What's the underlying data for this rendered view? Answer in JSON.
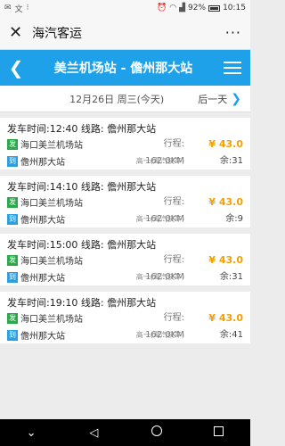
{
  "status": {
    "battery": "92%",
    "time": "10:15"
  },
  "wechat": {
    "title": "海汽客运"
  },
  "header": {
    "back_icon": "chevron-left-icon",
    "route": "美兰机场站 - 儋州那大站",
    "menu_icon": "hamburger-icon"
  },
  "date": {
    "current": "12月26日 周三(今天)",
    "next": "后一天"
  },
  "trips": [
    {
      "depart": "发车时间:12:40",
      "line": "线路: 儋州那大站",
      "from_tag": "发",
      "from": "海口美兰机场站",
      "to_tag": "到",
      "to": "儋州那大站",
      "distance": "行程: 162.0KM",
      "service": "高一(海汽快车)",
      "price": "¥ 43.0",
      "seats": "余:31"
    },
    {
      "depart": "发车时间:14:10",
      "line": "线路: 儋州那大站",
      "from_tag": "发",
      "from": "海口美兰机场站",
      "to_tag": "到",
      "to": "儋州那大站",
      "distance": "行程: 162.0KM",
      "service": "高一(海汽快车)",
      "price": "¥ 43.0",
      "seats": "余:9"
    },
    {
      "depart": "发车时间:15:00",
      "line": "线路: 儋州那大站",
      "from_tag": "发",
      "from": "海口美兰机场站",
      "to_tag": "到",
      "to": "儋州那大站",
      "distance": "行程: 162.0KM",
      "service": "高一(海汽快车)",
      "price": "¥ 43.0",
      "seats": "余:31"
    },
    {
      "depart": "发车时间:19:10",
      "line": "线路: 儋州那大站",
      "from_tag": "发",
      "from": "海口美兰机场站",
      "to_tag": "到",
      "to": "儋州那大站",
      "distance": "行程: 162.0KM",
      "service": "高一(海汽快车)",
      "price": "¥ 43.0",
      "seats": "余:41"
    }
  ],
  "colors": {
    "accent": "#1ea1e8",
    "price": "#f5a000",
    "depart_tag": "#2aa84a",
    "arrive_tag": "#2aa0e0"
  }
}
